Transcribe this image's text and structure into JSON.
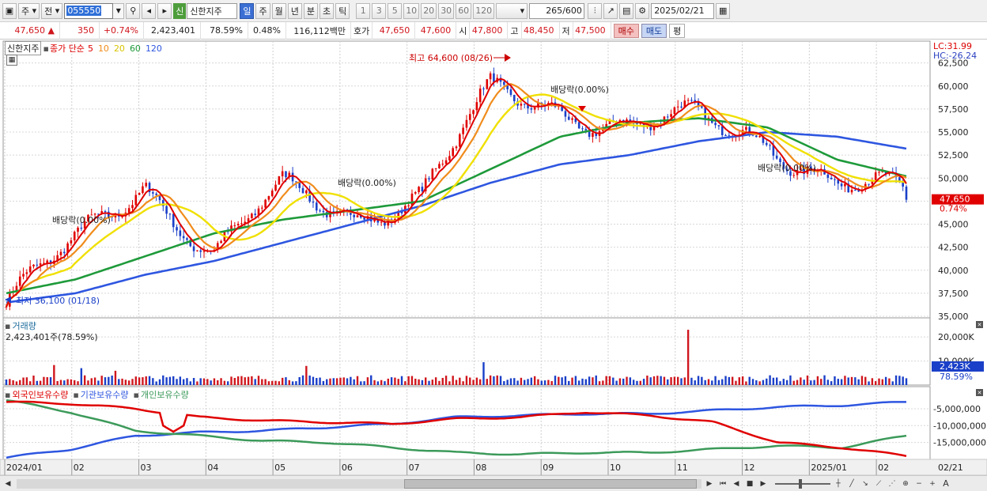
{
  "toolbar": {
    "period_main": "주",
    "prev_label": "전",
    "code": "055550",
    "badge": "신",
    "stock_name": "신한지주",
    "periods": [
      "일",
      "주",
      "월",
      "년",
      "분",
      "초",
      "틱"
    ],
    "active_period": "일",
    "intervals": [
      "1",
      "3",
      "5",
      "10",
      "20",
      "30",
      "60",
      "120"
    ],
    "count": "265",
    "count_total": "/600",
    "date": "2025/02/21"
  },
  "quote": {
    "price": "47,650",
    "change": "350",
    "change_pct": "+0.74%",
    "volume": "2,423,401",
    "volume_ratio": "78.59%",
    "turnover_pct": "0.48%",
    "amount": "116,112백만",
    "bid_label": "호가",
    "bid1": "47,650",
    "bid2": "47,600",
    "open_label": "시",
    "open": "47,800",
    "high_label": "고",
    "high": "48,450",
    "low_label": "저",
    "low": "47,500",
    "buy": "매수",
    "sell": "매도",
    "avg": "평"
  },
  "price_panel": {
    "name": "신한지주",
    "legend_prefix": "종가 단순",
    "ma": [
      {
        "label": "5",
        "color": "#e00000"
      },
      {
        "label": "10",
        "color": "#f08c1c"
      },
      {
        "label": "20",
        "color": "#f0e000"
      },
      {
        "label": "60",
        "color": "#1e9a3a"
      },
      {
        "label": "120",
        "color": "#2e56e0"
      }
    ],
    "lc": "LC:31.99",
    "hc": "HC:-26.24",
    "last_price": "47,650",
    "last_pct": "0.74%",
    "yticks": [
      "62,500",
      "60,000",
      "57,500",
      "55,000",
      "52,500",
      "50,000",
      "47,500",
      "45,000",
      "42,500",
      "40,000",
      "37,500",
      "35,000"
    ],
    "high_note": "최고 64,600 (08/26)",
    "low_note": "최저 36,100 (01/18)",
    "dividends": [
      "배당락(0.00%)",
      "배당락(0.00%)",
      "배당락(0.00%)",
      "배당락(0.00%)"
    ]
  },
  "volume_panel": {
    "title": "거래량",
    "value": "2,423,401주(78.59%)",
    "yticks": [
      "20,000K",
      "10,000K"
    ],
    "last": "2,423K",
    "last_pct": "78.59%"
  },
  "holding_panel": {
    "series": [
      {
        "label": "외국인보유수량",
        "color": "#e00000"
      },
      {
        "label": "기관보유수량",
        "color": "#2e56e0"
      },
      {
        "label": "개인보유수량",
        "color": "#3c9a5a"
      }
    ],
    "yticks": [
      "-5,000,000",
      "-10,000,000",
      "-15,000,000"
    ]
  },
  "xaxis": {
    "labels": [
      "2024/01",
      "02",
      "03",
      "04",
      "05",
      "06",
      "07",
      "08",
      "09",
      "10",
      "11",
      "12",
      "2025/01",
      "02"
    ],
    "end_label": "02/21"
  },
  "chart_data": {
    "type": "line",
    "x_months": [
      "2024/01",
      "02",
      "03",
      "04",
      "05",
      "06",
      "07",
      "08",
      "09",
      "10",
      "11",
      "12",
      "2025/01",
      "02"
    ],
    "close_approx": [
      36500,
      42500,
      50000,
      41500,
      48500,
      46500,
      48000,
      59000,
      58000,
      55500,
      56000,
      54500,
      49500,
      47650
    ],
    "ma120_approx": [
      36500,
      37500,
      39500,
      41000,
      43000,
      45000,
      47000,
      49500,
      51500,
      52500,
      54000,
      55000,
      54500,
      53200
    ],
    "ma60_approx": [
      37500,
      39000,
      41500,
      44000,
      45500,
      46500,
      47500,
      51000,
      54500,
      56000,
      56500,
      55500,
      52000,
      50200
    ],
    "high": {
      "value": 64600,
      "date": "08/26"
    },
    "low": {
      "value": 36100,
      "date": "01/18"
    },
    "ylim": [
      35000,
      63500
    ]
  }
}
